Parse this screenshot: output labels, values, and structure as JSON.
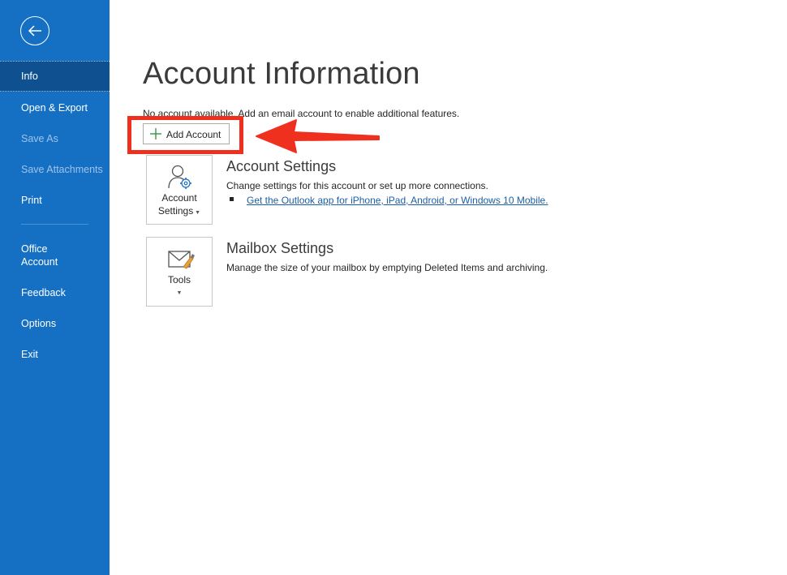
{
  "sidebar": {
    "items": [
      {
        "label": "Info"
      },
      {
        "label": "Open & Export"
      },
      {
        "label": "Save As"
      },
      {
        "label": "Save Attachments"
      },
      {
        "label": "Print"
      },
      {
        "label": "Office"
      },
      {
        "label": "Account"
      },
      {
        "label": "Feedback"
      },
      {
        "label": "Options"
      },
      {
        "label": "Exit"
      }
    ]
  },
  "main": {
    "title": "Account Information",
    "info_text": "No account available. Add an email account to enable additional features.",
    "add_account_label": "Add Account",
    "account_settings": {
      "tile_line1": "Account",
      "tile_line2": "Settings",
      "title": "Account Settings",
      "description": "Change settings for this account or set up more connections.",
      "link": "Get the Outlook app for iPhone, iPad, Android, or Windows 10 Mobile."
    },
    "mailbox_settings": {
      "tile_label": "Tools",
      "title": "Mailbox Settings",
      "description": "Manage the size of your mailbox by emptying Deleted Items and archiving."
    }
  },
  "colors": {
    "sidebar_bg": "#1570c4",
    "sidebar_active": "#0f5190",
    "annotation_red": "#f0301f",
    "link": "#1b5fa8"
  },
  "icons": [
    "back-arrow-icon",
    "plus-icon",
    "account-gear-icon",
    "tools-mail-brush-icon"
  ]
}
